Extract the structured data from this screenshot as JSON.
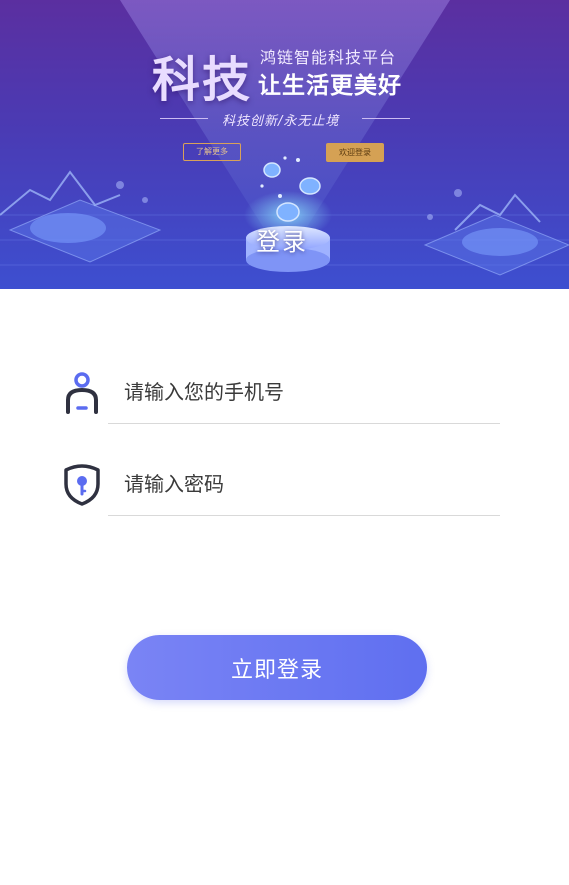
{
  "banner": {
    "big_title": "科技",
    "brand_line": "鸿链智能科技平台",
    "slogan": "让生活更美好",
    "tagline": "科技创新/永无止境",
    "more_button": "了解更多",
    "welcome_button": "欢迎登录",
    "login_title": "登录"
  },
  "form": {
    "phone": {
      "value": "",
      "placeholder": "请输入您的手机号",
      "icon": "user-icon"
    },
    "password": {
      "value": "",
      "placeholder": "请输入密码",
      "icon": "shield-key-icon"
    },
    "submit_label": "立即登录"
  },
  "colors": {
    "accent": "#6877f2",
    "banner_top": "#5b2fa0",
    "banner_bottom": "#3d4fd0",
    "icon_dark": "#2f3140",
    "icon_accent": "#5b6cf0"
  }
}
